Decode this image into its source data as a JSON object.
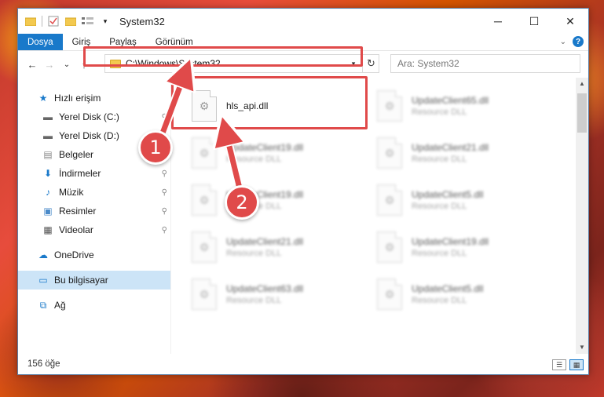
{
  "window": {
    "title": "System32",
    "controls": {
      "minimize": "─",
      "maximize": "☐",
      "close": "✕"
    }
  },
  "ribbon": {
    "tabs": [
      "Dosya",
      "Giriş",
      "Paylaş",
      "Görünüm"
    ],
    "active_tab": "Dosya",
    "help": "?"
  },
  "nav": {
    "back": "←",
    "forward": "→",
    "recent": "⌄",
    "up": "↑",
    "address": "C:\\Windows\\System32",
    "refresh": "↻",
    "search_placeholder": "Ara: System32"
  },
  "sidebar": {
    "items": [
      {
        "label": "Hızlı erişim",
        "icon": "star-icon",
        "glyph": "★",
        "pinned": false
      },
      {
        "label": "Yerel Disk (C:)",
        "icon": "drive-icon",
        "glyph": "▬",
        "pinned": true
      },
      {
        "label": "Yerel Disk (D:)",
        "icon": "drive-icon",
        "glyph": "▬",
        "pinned": true
      },
      {
        "label": "Belgeler",
        "icon": "documents-icon",
        "glyph": "▤",
        "pinned": true
      },
      {
        "label": "İndirmeler",
        "icon": "download-icon",
        "glyph": "⬇",
        "pinned": true
      },
      {
        "label": "Müzik",
        "icon": "music-icon",
        "glyph": "♪",
        "pinned": true
      },
      {
        "label": "Resimler",
        "icon": "pictures-icon",
        "glyph": "▣",
        "pinned": true
      },
      {
        "label": "Videolar",
        "icon": "videos-icon",
        "glyph": "▦",
        "pinned": true
      },
      {
        "label": "OneDrive",
        "icon": "cloud-icon",
        "glyph": "☁",
        "pinned": false
      },
      {
        "label": "Bu bilgisayar",
        "icon": "computer-icon",
        "glyph": "▭",
        "pinned": false
      },
      {
        "label": "Ağ",
        "icon": "network-icon",
        "glyph": "⧉",
        "pinned": false
      }
    ],
    "selected": "Bu bilgisayar",
    "pin_glyph": "📌"
  },
  "files": [
    {
      "name": "hls_api.dll",
      "type": "",
      "highlighted": true
    },
    {
      "name": "UpdateClient65.dll",
      "type": "Resource DLL"
    },
    {
      "name": "UpdateClient19.dll",
      "type": "Resource DLL"
    },
    {
      "name": "UpdateClient21.dll",
      "type": "Resource DLL"
    },
    {
      "name": "UpdateClient19.dll",
      "type": "Resource DLL"
    },
    {
      "name": "UpdateClient5.dll",
      "type": "Resource DLL"
    },
    {
      "name": "UpdateClient21.dll",
      "type": "Resource DLL"
    },
    {
      "name": "UpdateClient19.dll",
      "type": "Resource DLL"
    },
    {
      "name": "UpdateClient63.dll",
      "type": "Resource DLL"
    },
    {
      "name": "UpdateClient5.dll",
      "type": "Resource DLL"
    }
  ],
  "status": {
    "count": "156 öğe"
  },
  "callouts": [
    "1",
    "2"
  ],
  "colors": {
    "accent": "#1979ca",
    "highlight": "#e04a4a",
    "selected_bg": "#cce4f7"
  }
}
